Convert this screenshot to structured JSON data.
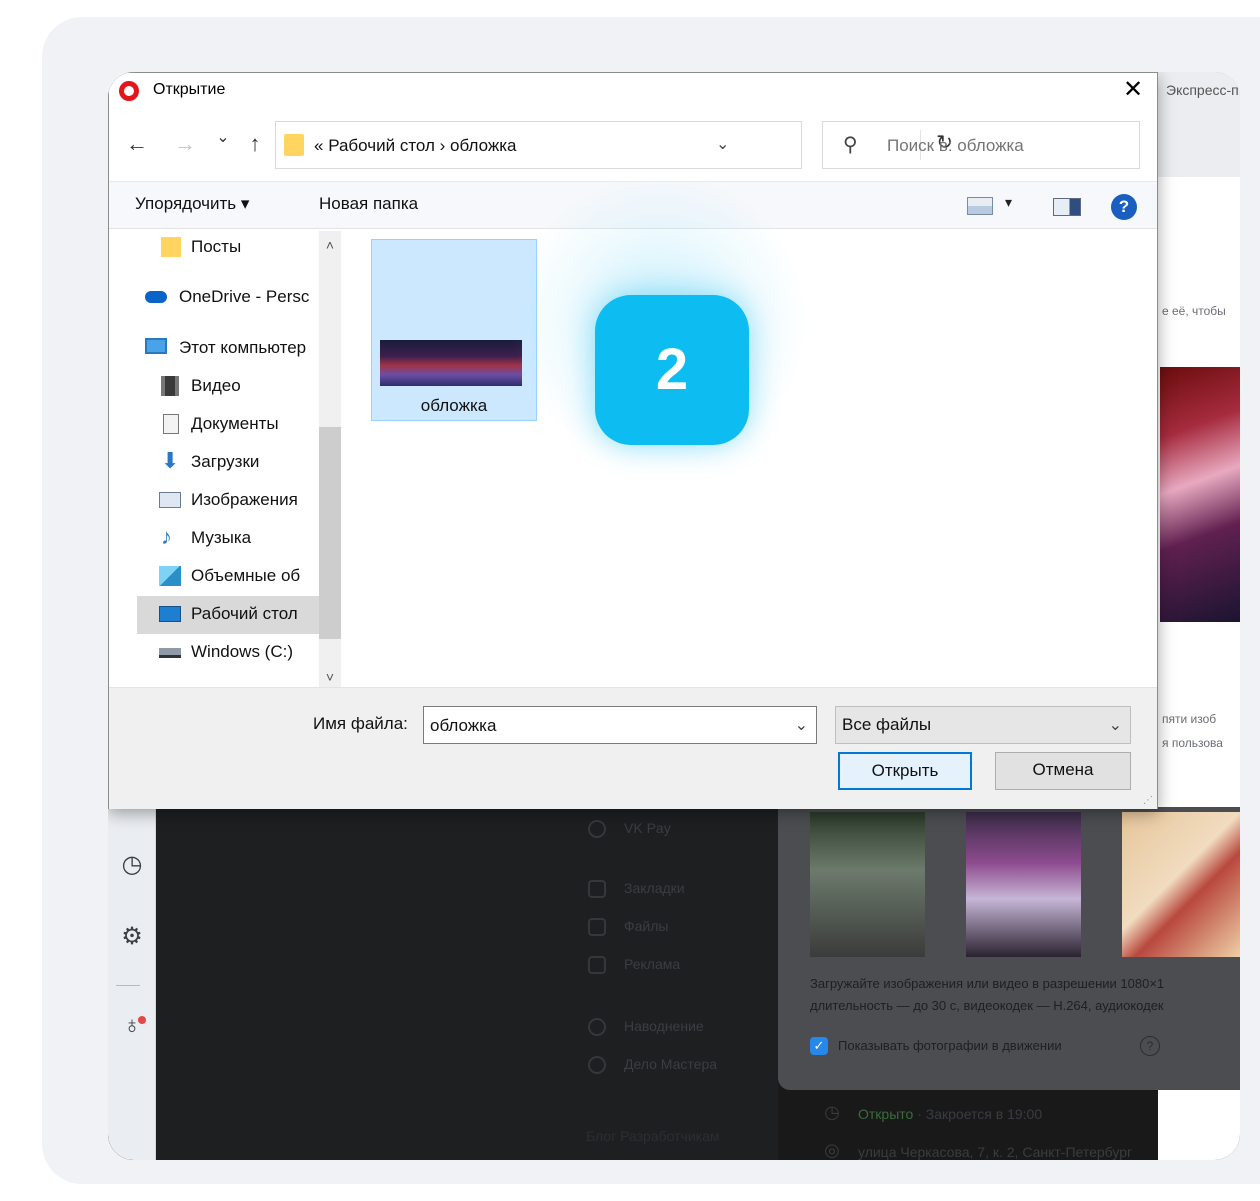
{
  "dialog": {
    "title": "Открытие",
    "close": "✕",
    "nav": {
      "back": "←",
      "forward": "→",
      "recent": "⌄",
      "up": "↑"
    },
    "address": {
      "chevron": "«",
      "segments_text": "Рабочий стол  ›  обложка",
      "dropdown": "⌄"
    },
    "refresh": "↻",
    "search": {
      "icon": "search-icon",
      "placeholder": "Поиск в: обложка"
    },
    "toolbar": {
      "organize": "Упорядочить ▾",
      "new_folder": "Новая папка",
      "view_dropdown": "▾",
      "help": "?"
    },
    "sidebar": {
      "items": [
        {
          "label": "Посты",
          "icon": "folder-icon"
        },
        {
          "label": "OneDrive - Persc",
          "icon": "cloud-icon"
        },
        {
          "label": "Этот компьютер",
          "icon": "computer-icon"
        },
        {
          "label": "Видео",
          "icon": "video-icon"
        },
        {
          "label": "Документы",
          "icon": "documents-icon"
        },
        {
          "label": "Загрузки",
          "icon": "download-icon"
        },
        {
          "label": "Изображения",
          "icon": "pictures-icon"
        },
        {
          "label": "Музыка",
          "icon": "music-icon"
        },
        {
          "label": "Объемные об",
          "icon": "3d-objects-icon"
        },
        {
          "label": "Рабочий стол",
          "icon": "desktop-icon",
          "selected": true
        },
        {
          "label": "Windows (C:)",
          "icon": "drive-icon"
        }
      ],
      "scroll_up": "˄",
      "scroll_down": "˅"
    },
    "files": [
      {
        "name": "обложка"
      }
    ],
    "bottom": {
      "filename_label": "Имя файла:",
      "filename_value": "обложка",
      "filetype_value": "Все файлы",
      "dropdown": "⌄",
      "open": "Открыть",
      "cancel": "Отмена"
    }
  },
  "badge": {
    "number": "2"
  },
  "background": {
    "top_tab_text": "Экспресс-п",
    "right_fragments": [
      "е её, чтобы",
      "пяти изоб",
      "я пользова"
    ],
    "menu": [
      "VK Pay",
      "Закладки",
      "Файлы",
      "Реклама",
      "Наводнение",
      "Дело Мастера"
    ],
    "footer_links": "Блог   Разработчикам",
    "hint_text_1": "Загружайте изображения или видео в разрешении 1080×1",
    "hint_text_2": "длительность — до 30 с, видеокодек — H.264, аудиокодек",
    "checkbox_label": "Показывать фотографии в движении",
    "open_status": "Открыто",
    "close_time": " · Закроется в 19:00",
    "address": "улица Черкасова, 7, к. 2, Санкт-Петербург"
  },
  "colors": {
    "accent": "#0dbcf0",
    "selection": "#cce8ff",
    "opera": "#e4161b"
  }
}
